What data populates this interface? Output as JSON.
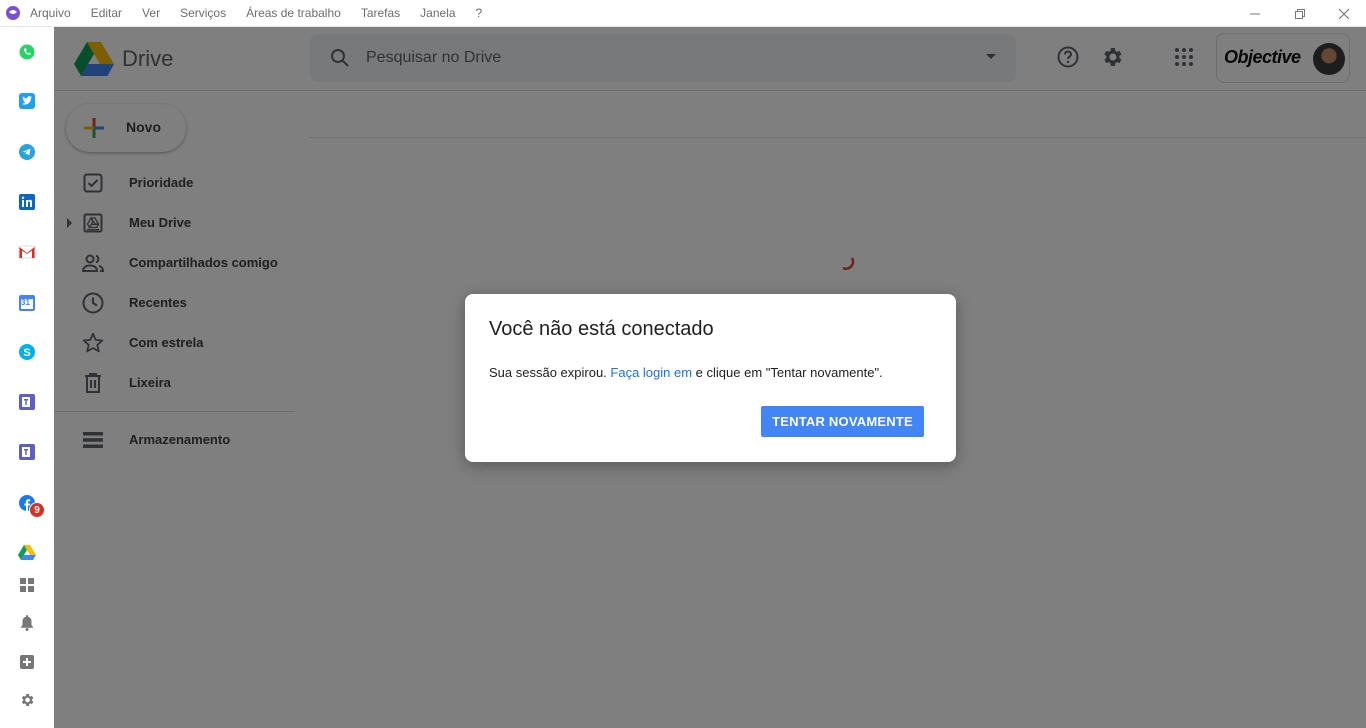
{
  "menubar": {
    "items": [
      "Arquivo",
      "Editar",
      "Ver",
      "Serviços",
      "Áreas de trabalho",
      "Tarefas",
      "Janela",
      "?"
    ],
    "controls": [
      "minimize-icon",
      "restore-icon",
      "close-icon"
    ]
  },
  "rail": {
    "services": [
      "whatsapp-icon",
      "twitter-icon",
      "telegram-icon",
      "linkedin-icon",
      "gmail-icon",
      "google-calendar-icon",
      "skype-icon",
      "teams-icon",
      "teams-icon",
      "facebook-icon",
      "google-drive-icon"
    ],
    "calendar_day": "31",
    "facebook_badge": "9",
    "bottom": [
      "grid-icon",
      "bell-icon",
      "add-icon",
      "gear-icon"
    ]
  },
  "header": {
    "title": "Drive",
    "search_placeholder": "Pesquisar no Drive",
    "account_label": "Objective"
  },
  "sidebar": {
    "new_label": "Novo",
    "items": [
      {
        "label": "Prioridade",
        "icon": "priority-check-icon"
      },
      {
        "label": "Meu Drive",
        "icon": "my-drive-icon"
      },
      {
        "label": "Compartilhados comigo",
        "icon": "shared-people-icon"
      },
      {
        "label": "Recentes",
        "icon": "clock-icon"
      },
      {
        "label": "Com estrela",
        "icon": "star-icon"
      },
      {
        "label": "Lixeira",
        "icon": "trash-icon"
      }
    ],
    "storage_label": "Armazenamento"
  },
  "dialog": {
    "title": "Você não está conectado",
    "body_prefix": "Sua sessão expirou. ",
    "body_link": "Faça login em",
    "body_suffix": " e clique em \"Tentar novamente\".",
    "button": "TENTAR NOVAMENTE"
  },
  "colors": {
    "accent": "#4285f4",
    "link": "#1a73e8",
    "overlay": "#000000"
  }
}
